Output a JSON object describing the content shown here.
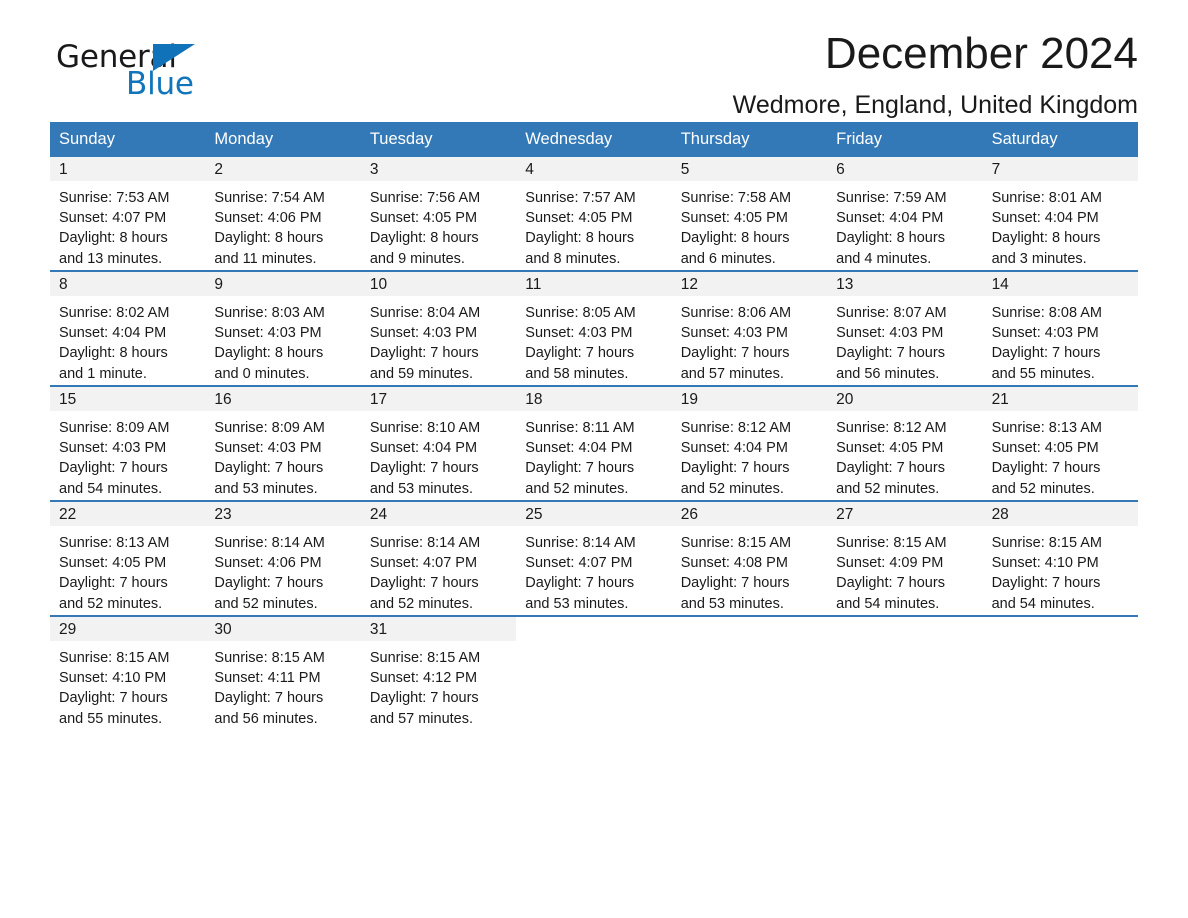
{
  "brand": {
    "word_one": "General",
    "word_two": "Blue",
    "accent_color": "#1072b8",
    "triangle_icon": "triangle-icon"
  },
  "header": {
    "month_title": "December 2024",
    "location": "Wedmore, England, United Kingdom"
  },
  "calendar": {
    "header_bg": "#3479b7",
    "daynum_bg": "#f2f2f2",
    "weekdays": [
      "Sunday",
      "Monday",
      "Tuesday",
      "Wednesday",
      "Thursday",
      "Friday",
      "Saturday"
    ],
    "weeks": [
      [
        {
          "day": "1",
          "sunrise": "Sunrise: 7:53 AM",
          "sunset": "Sunset: 4:07 PM",
          "daylight_1": "Daylight: 8 hours",
          "daylight_2": "and 13 minutes."
        },
        {
          "day": "2",
          "sunrise": "Sunrise: 7:54 AM",
          "sunset": "Sunset: 4:06 PM",
          "daylight_1": "Daylight: 8 hours",
          "daylight_2": "and 11 minutes."
        },
        {
          "day": "3",
          "sunrise": "Sunrise: 7:56 AM",
          "sunset": "Sunset: 4:05 PM",
          "daylight_1": "Daylight: 8 hours",
          "daylight_2": "and 9 minutes."
        },
        {
          "day": "4",
          "sunrise": "Sunrise: 7:57 AM",
          "sunset": "Sunset: 4:05 PM",
          "daylight_1": "Daylight: 8 hours",
          "daylight_2": "and 8 minutes."
        },
        {
          "day": "5",
          "sunrise": "Sunrise: 7:58 AM",
          "sunset": "Sunset: 4:05 PM",
          "daylight_1": "Daylight: 8 hours",
          "daylight_2": "and 6 minutes."
        },
        {
          "day": "6",
          "sunrise": "Sunrise: 7:59 AM",
          "sunset": "Sunset: 4:04 PM",
          "daylight_1": "Daylight: 8 hours",
          "daylight_2": "and 4 minutes."
        },
        {
          "day": "7",
          "sunrise": "Sunrise: 8:01 AM",
          "sunset": "Sunset: 4:04 PM",
          "daylight_1": "Daylight: 8 hours",
          "daylight_2": "and 3 minutes."
        }
      ],
      [
        {
          "day": "8",
          "sunrise": "Sunrise: 8:02 AM",
          "sunset": "Sunset: 4:04 PM",
          "daylight_1": "Daylight: 8 hours",
          "daylight_2": "and 1 minute."
        },
        {
          "day": "9",
          "sunrise": "Sunrise: 8:03 AM",
          "sunset": "Sunset: 4:03 PM",
          "daylight_1": "Daylight: 8 hours",
          "daylight_2": "and 0 minutes."
        },
        {
          "day": "10",
          "sunrise": "Sunrise: 8:04 AM",
          "sunset": "Sunset: 4:03 PM",
          "daylight_1": "Daylight: 7 hours",
          "daylight_2": "and 59 minutes."
        },
        {
          "day": "11",
          "sunrise": "Sunrise: 8:05 AM",
          "sunset": "Sunset: 4:03 PM",
          "daylight_1": "Daylight: 7 hours",
          "daylight_2": "and 58 minutes."
        },
        {
          "day": "12",
          "sunrise": "Sunrise: 8:06 AM",
          "sunset": "Sunset: 4:03 PM",
          "daylight_1": "Daylight: 7 hours",
          "daylight_2": "and 57 minutes."
        },
        {
          "day": "13",
          "sunrise": "Sunrise: 8:07 AM",
          "sunset": "Sunset: 4:03 PM",
          "daylight_1": "Daylight: 7 hours",
          "daylight_2": "and 56 minutes."
        },
        {
          "day": "14",
          "sunrise": "Sunrise: 8:08 AM",
          "sunset": "Sunset: 4:03 PM",
          "daylight_1": "Daylight: 7 hours",
          "daylight_2": "and 55 minutes."
        }
      ],
      [
        {
          "day": "15",
          "sunrise": "Sunrise: 8:09 AM",
          "sunset": "Sunset: 4:03 PM",
          "daylight_1": "Daylight: 7 hours",
          "daylight_2": "and 54 minutes."
        },
        {
          "day": "16",
          "sunrise": "Sunrise: 8:09 AM",
          "sunset": "Sunset: 4:03 PM",
          "daylight_1": "Daylight: 7 hours",
          "daylight_2": "and 53 minutes."
        },
        {
          "day": "17",
          "sunrise": "Sunrise: 8:10 AM",
          "sunset": "Sunset: 4:04 PM",
          "daylight_1": "Daylight: 7 hours",
          "daylight_2": "and 53 minutes."
        },
        {
          "day": "18",
          "sunrise": "Sunrise: 8:11 AM",
          "sunset": "Sunset: 4:04 PM",
          "daylight_1": "Daylight: 7 hours",
          "daylight_2": "and 52 minutes."
        },
        {
          "day": "19",
          "sunrise": "Sunrise: 8:12 AM",
          "sunset": "Sunset: 4:04 PM",
          "daylight_1": "Daylight: 7 hours",
          "daylight_2": "and 52 minutes."
        },
        {
          "day": "20",
          "sunrise": "Sunrise: 8:12 AM",
          "sunset": "Sunset: 4:05 PM",
          "daylight_1": "Daylight: 7 hours",
          "daylight_2": "and 52 minutes."
        },
        {
          "day": "21",
          "sunrise": "Sunrise: 8:13 AM",
          "sunset": "Sunset: 4:05 PM",
          "daylight_1": "Daylight: 7 hours",
          "daylight_2": "and 52 minutes."
        }
      ],
      [
        {
          "day": "22",
          "sunrise": "Sunrise: 8:13 AM",
          "sunset": "Sunset: 4:05 PM",
          "daylight_1": "Daylight: 7 hours",
          "daylight_2": "and 52 minutes."
        },
        {
          "day": "23",
          "sunrise": "Sunrise: 8:14 AM",
          "sunset": "Sunset: 4:06 PM",
          "daylight_1": "Daylight: 7 hours",
          "daylight_2": "and 52 minutes."
        },
        {
          "day": "24",
          "sunrise": "Sunrise: 8:14 AM",
          "sunset": "Sunset: 4:07 PM",
          "daylight_1": "Daylight: 7 hours",
          "daylight_2": "and 52 minutes."
        },
        {
          "day": "25",
          "sunrise": "Sunrise: 8:14 AM",
          "sunset": "Sunset: 4:07 PM",
          "daylight_1": "Daylight: 7 hours",
          "daylight_2": "and 53 minutes."
        },
        {
          "day": "26",
          "sunrise": "Sunrise: 8:15 AM",
          "sunset": "Sunset: 4:08 PM",
          "daylight_1": "Daylight: 7 hours",
          "daylight_2": "and 53 minutes."
        },
        {
          "day": "27",
          "sunrise": "Sunrise: 8:15 AM",
          "sunset": "Sunset: 4:09 PM",
          "daylight_1": "Daylight: 7 hours",
          "daylight_2": "and 54 minutes."
        },
        {
          "day": "28",
          "sunrise": "Sunrise: 8:15 AM",
          "sunset": "Sunset: 4:10 PM",
          "daylight_1": "Daylight: 7 hours",
          "daylight_2": "and 54 minutes."
        }
      ],
      [
        {
          "day": "29",
          "sunrise": "Sunrise: 8:15 AM",
          "sunset": "Sunset: 4:10 PM",
          "daylight_1": "Daylight: 7 hours",
          "daylight_2": "and 55 minutes."
        },
        {
          "day": "30",
          "sunrise": "Sunrise: 8:15 AM",
          "sunset": "Sunset: 4:11 PM",
          "daylight_1": "Daylight: 7 hours",
          "daylight_2": "and 56 minutes."
        },
        {
          "day": "31",
          "sunrise": "Sunrise: 8:15 AM",
          "sunset": "Sunset: 4:12 PM",
          "daylight_1": "Daylight: 7 hours",
          "daylight_2": "and 57 minutes."
        },
        {
          "day": "",
          "sunrise": "",
          "sunset": "",
          "daylight_1": "",
          "daylight_2": ""
        },
        {
          "day": "",
          "sunrise": "",
          "sunset": "",
          "daylight_1": "",
          "daylight_2": ""
        },
        {
          "day": "",
          "sunrise": "",
          "sunset": "",
          "daylight_1": "",
          "daylight_2": ""
        },
        {
          "day": "",
          "sunrise": "",
          "sunset": "",
          "daylight_1": "",
          "daylight_2": ""
        }
      ]
    ]
  }
}
